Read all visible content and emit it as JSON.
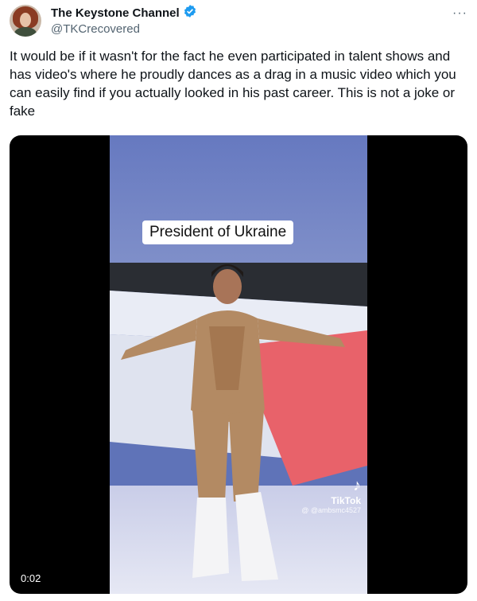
{
  "author": {
    "display_name": "The Keystone Channel",
    "handle": "@TKCrecovered",
    "verified_icon": "verified-badge-icon",
    "more_label": "···"
  },
  "tweet": {
    "text": "It would be if it wasn't for the fact he even participated  in talent shows and has video's where he proudly dances as a drag in a music video which you can easily find if you actually looked in his past career. This is not a joke or fake"
  },
  "video": {
    "caption": "President of Ukraine",
    "watermark_logo": "tiktok-icon",
    "watermark_name": "TikTok",
    "watermark_handle": "@ @ambsmc4527",
    "timestamp": "0:02"
  },
  "colors": {
    "verified_blue": "#1d9bf0",
    "secondary_text": "#536471"
  }
}
